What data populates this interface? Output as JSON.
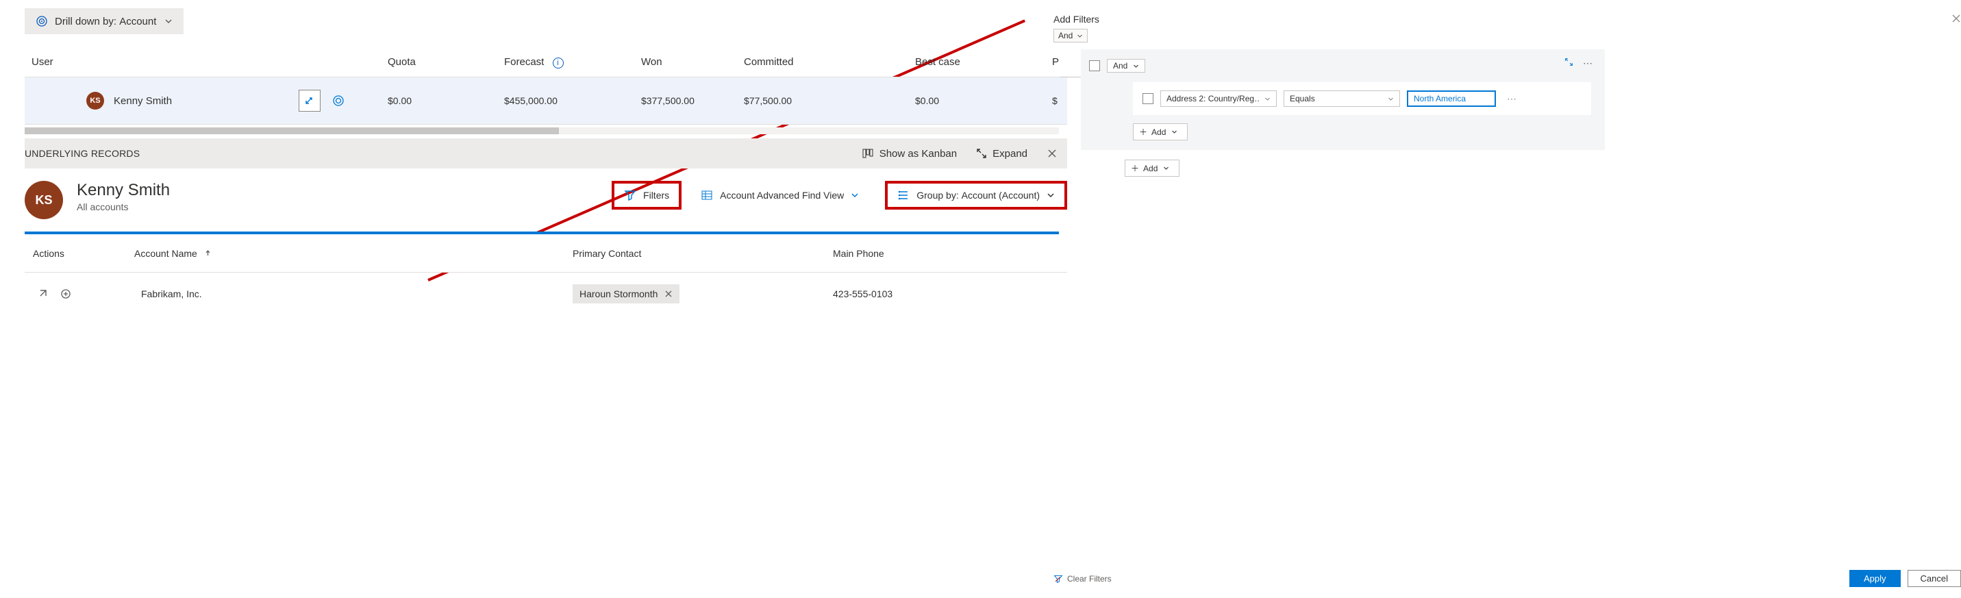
{
  "drilldown": {
    "prefix": "Drill down by:",
    "value": "Account"
  },
  "forecast_headers": {
    "user": "User",
    "quota": "Quota",
    "forecast": "Forecast",
    "won": "Won",
    "committed": "Committed",
    "best": "Best case",
    "last": "P"
  },
  "forecast_row": {
    "initials": "KS",
    "name": "Kenny Smith",
    "quota": "$0.00",
    "forecast": "$455,000.00",
    "won": "$377,500.00",
    "committed": "$77,500.00",
    "best": "$0.00",
    "last": "$"
  },
  "underlying": {
    "title": "UNDERLYING RECORDS",
    "kanban": "Show as Kanban",
    "expand": "Expand"
  },
  "detail": {
    "initials": "KS",
    "name": "Kenny Smith",
    "sub": "All accounts",
    "filters": "Filters",
    "view": "Account Advanced Find View",
    "groupby_label": "Group by:",
    "groupby_value": "Account (Account)"
  },
  "table": {
    "headers": {
      "actions": "Actions",
      "account": "Account Name",
      "contact": "Primary Contact",
      "phone": "Main Phone"
    },
    "row": {
      "account": "Fabrikam, Inc.",
      "contact": "Haroun Stormonth",
      "phone": "423-555-0103"
    }
  },
  "filter_panel": {
    "title": "Add Filters",
    "and": "And",
    "field": "Address 2: Country/Reg…",
    "operator": "Equals",
    "value": "North America",
    "add": "Add",
    "clear": "Clear Filters",
    "apply": "Apply",
    "cancel": "Cancel"
  }
}
